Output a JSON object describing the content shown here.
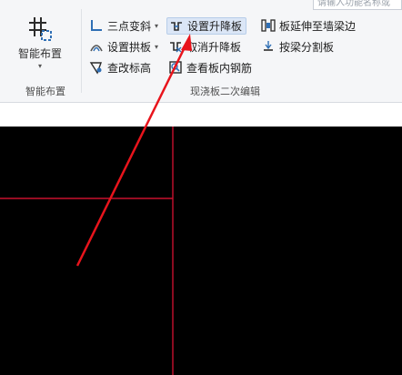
{
  "search": {
    "placeholder": "请输入功能名称或"
  },
  "groups": {
    "smart_layout": {
      "button_label": "智能布置",
      "group_label": "智能布置"
    },
    "slab_edit": {
      "group_label": "现浇板二次编辑",
      "commands": [
        {
          "label": "三点变斜",
          "icon": "three-point-slope-icon",
          "has_dropdown": true
        },
        {
          "label": "设置拱板",
          "icon": "arch-slab-icon",
          "has_dropdown": true
        },
        {
          "label": "查改标高",
          "icon": "elevation-icon",
          "has_dropdown": false
        },
        {
          "label": "设置升降板",
          "icon": "raise-lower-slab-icon",
          "has_dropdown": false,
          "highlighted": true
        },
        {
          "label": "取消升降板",
          "icon": "cancel-raise-lower-icon",
          "has_dropdown": false
        },
        {
          "label": "查看板内钢筋",
          "icon": "view-rebar-icon",
          "has_dropdown": false
        },
        {
          "label": "板延伸至墙梁边",
          "icon": "extend-slab-icon",
          "has_dropdown": false
        },
        {
          "label": "按梁分割板",
          "icon": "split-by-beam-icon",
          "has_dropdown": false
        }
      ]
    }
  },
  "colors": {
    "canvas_background": "#000000",
    "grid_line": "#c8102e",
    "annotation_arrow": "#e8141c",
    "highlight": "#dbe6f6",
    "icon_blue": "#2f6fb5"
  }
}
